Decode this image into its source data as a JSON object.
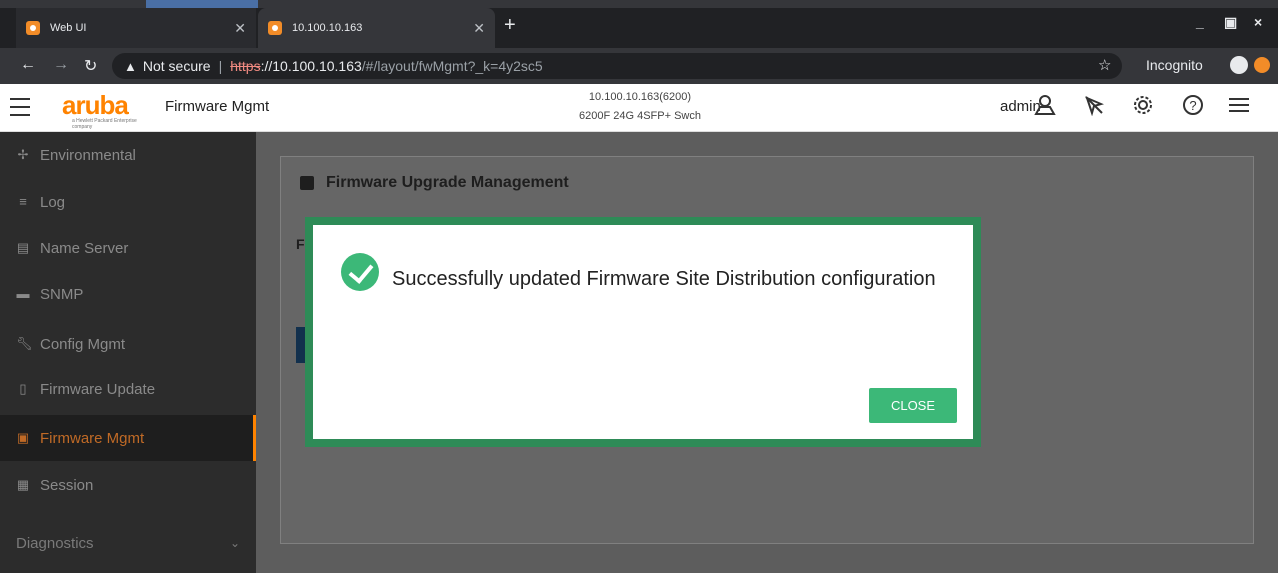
{
  "browser": {
    "tabs": [
      {
        "title": "Web UI",
        "active": false
      },
      {
        "title": "10.100.10.163",
        "active": true
      }
    ],
    "new_tab": "+",
    "window_controls": [
      "_",
      "▣",
      "×"
    ],
    "url": {
      "security_label": "Not secure",
      "scheme": "https",
      "host": "://10.100.10.163",
      "path": "/#/layout/fwMgmt?_k=4y2sc5"
    },
    "incognito_label": "Incognito"
  },
  "header": {
    "logo": "aruba",
    "logo_sub": "a Hewlett Packard Enterprise company",
    "title": "Firmware Mgmt",
    "device_line1": "10.100.10.163(6200)",
    "device_line2": "6200F 24G 4SFP+ Swch",
    "user": "admin",
    "icons": [
      "user-icon",
      "location-off-icon",
      "gear-icon",
      "help-icon",
      "menu-icon"
    ]
  },
  "sidebar": {
    "items": [
      {
        "label": "Environmental",
        "icon": "fan-icon",
        "active": false
      },
      {
        "label": "Log",
        "icon": "list-icon",
        "active": false
      },
      {
        "label": "Name Server",
        "icon": "server-icon",
        "active": false
      },
      {
        "label": "SNMP",
        "icon": "snmp-icon",
        "active": false
      },
      {
        "label": "Config Mgmt",
        "icon": "wrench-icon",
        "active": false
      },
      {
        "label": "Firmware Update",
        "icon": "firmware-icon",
        "active": false
      },
      {
        "label": "Firmware Mgmt",
        "icon": "firmware-mgmt-icon",
        "active": true
      },
      {
        "label": "Session",
        "icon": "clipboard-icon",
        "active": false
      }
    ],
    "section": "Diagnostics"
  },
  "panel": {
    "title": "Firmware Upgrade Management",
    "fragment_letter": "F"
  },
  "dialog": {
    "message": "Successfully updated Firmware Site Distribution configuration",
    "close_label": "CLOSE"
  },
  "colors": {
    "brand": "#ff8300",
    "success": "#3cb878",
    "dialog_border": "#2e8b57"
  }
}
